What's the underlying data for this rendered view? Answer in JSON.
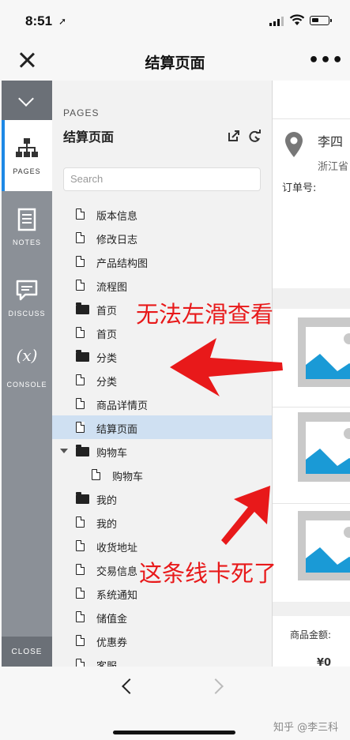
{
  "status_bar": {
    "time": "8:51",
    "location_arrow": "➚"
  },
  "navbar": {
    "title": "结算页面",
    "close_icon": "close-icon",
    "more_label": "•••"
  },
  "rail": {
    "items": [
      {
        "label": "PAGES",
        "icon": "sitemap-icon",
        "active": true
      },
      {
        "label": "NOTES",
        "icon": "notes-icon",
        "active": false
      },
      {
        "label": "DISCUSS",
        "icon": "discuss-icon",
        "active": false
      },
      {
        "label": "CONSOLE",
        "icon": "console-icon",
        "glyph": "(x)",
        "active": false
      }
    ],
    "close_label": "CLOSE"
  },
  "panel": {
    "heading": "PAGES",
    "title": "结算页面",
    "search_placeholder": "Search",
    "tree": [
      {
        "label": "版本信息",
        "type": "page"
      },
      {
        "label": "修改日志",
        "type": "page"
      },
      {
        "label": "产品结构图",
        "type": "page"
      },
      {
        "label": "流程图",
        "type": "page"
      },
      {
        "label": "首页",
        "type": "folder"
      },
      {
        "label": "首页",
        "type": "page"
      },
      {
        "label": "分类",
        "type": "folder"
      },
      {
        "label": "分类",
        "type": "page"
      },
      {
        "label": "商品详情页",
        "type": "page"
      },
      {
        "label": "结算页面",
        "type": "page",
        "selected": true
      },
      {
        "label": "购物车",
        "type": "folder",
        "expanded": true
      },
      {
        "label": "购物车",
        "type": "page",
        "indent": 1
      },
      {
        "label": "我的",
        "type": "folder"
      },
      {
        "label": "我的",
        "type": "page"
      },
      {
        "label": "收货地址",
        "type": "page"
      },
      {
        "label": "交易信息",
        "type": "page"
      },
      {
        "label": "系统通知",
        "type": "page"
      },
      {
        "label": "储值金",
        "type": "page"
      },
      {
        "label": "优惠券",
        "type": "page"
      },
      {
        "label": "客服",
        "type": "page"
      }
    ]
  },
  "preview": {
    "name": "李四",
    "address": "浙江省",
    "order_label": "订单号:",
    "amount_label": "商品金额:",
    "amount_value": "¥0"
  },
  "annotations": {
    "top": "无法左滑查看",
    "bottom": "这条线卡死了"
  },
  "bottombar": {
    "watermark": "知乎 @李三科"
  },
  "colors": {
    "accent": "#1e88e5",
    "annotation": "#e8191a",
    "selected_row": "#cfe0f2",
    "rail": "#8b9097",
    "image_blue": "#1a9ad6"
  }
}
